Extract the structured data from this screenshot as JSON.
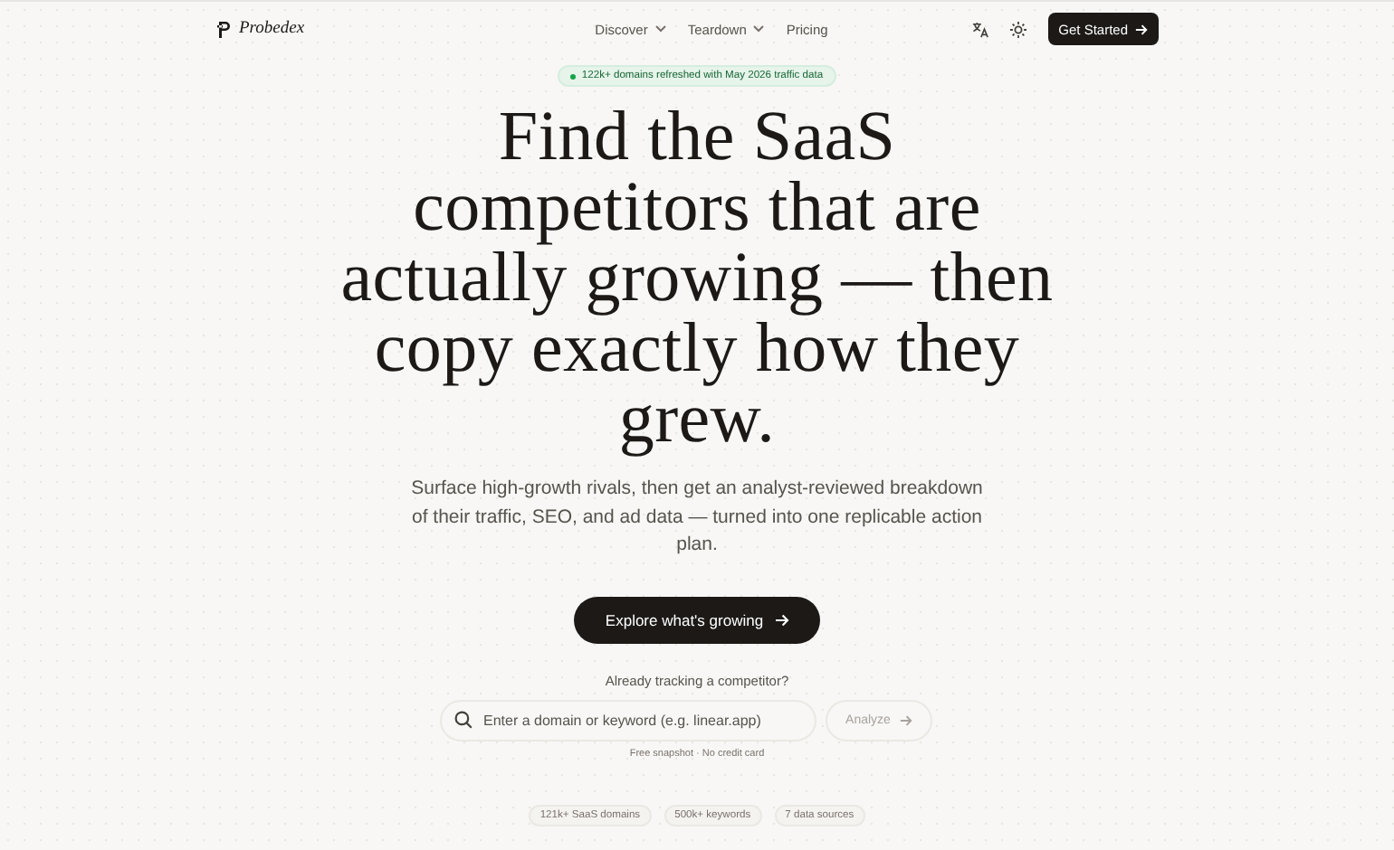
{
  "nav": {
    "brand": "Probedex",
    "links": [
      {
        "label": "Discover",
        "dropdown": true
      },
      {
        "label": "Teardown",
        "dropdown": true
      },
      {
        "label": "Pricing",
        "dropdown": false
      }
    ],
    "cta": "Get Started"
  },
  "announcement": "122k+ domains refreshed with May 2026 traffic data",
  "headline": "Find the SaaS competitors that are actually growing — then copy exactly how they grew.",
  "subheadline": "Surface high-growth rivals, then get an analyst-reviewed breakdown of their traffic, SEO, and ad data — turned into one replicable action plan.",
  "primary_button": "Explore what's growing",
  "search": {
    "label": "Already tracking a competitor?",
    "placeholder": "Enter a domain or keyword (e.g. linear.app)",
    "button": "Analyze",
    "note": "Free snapshot · No credit card"
  },
  "stats": [
    "121k+ SaaS domains",
    "500k+ keywords",
    "7 data sources"
  ]
}
